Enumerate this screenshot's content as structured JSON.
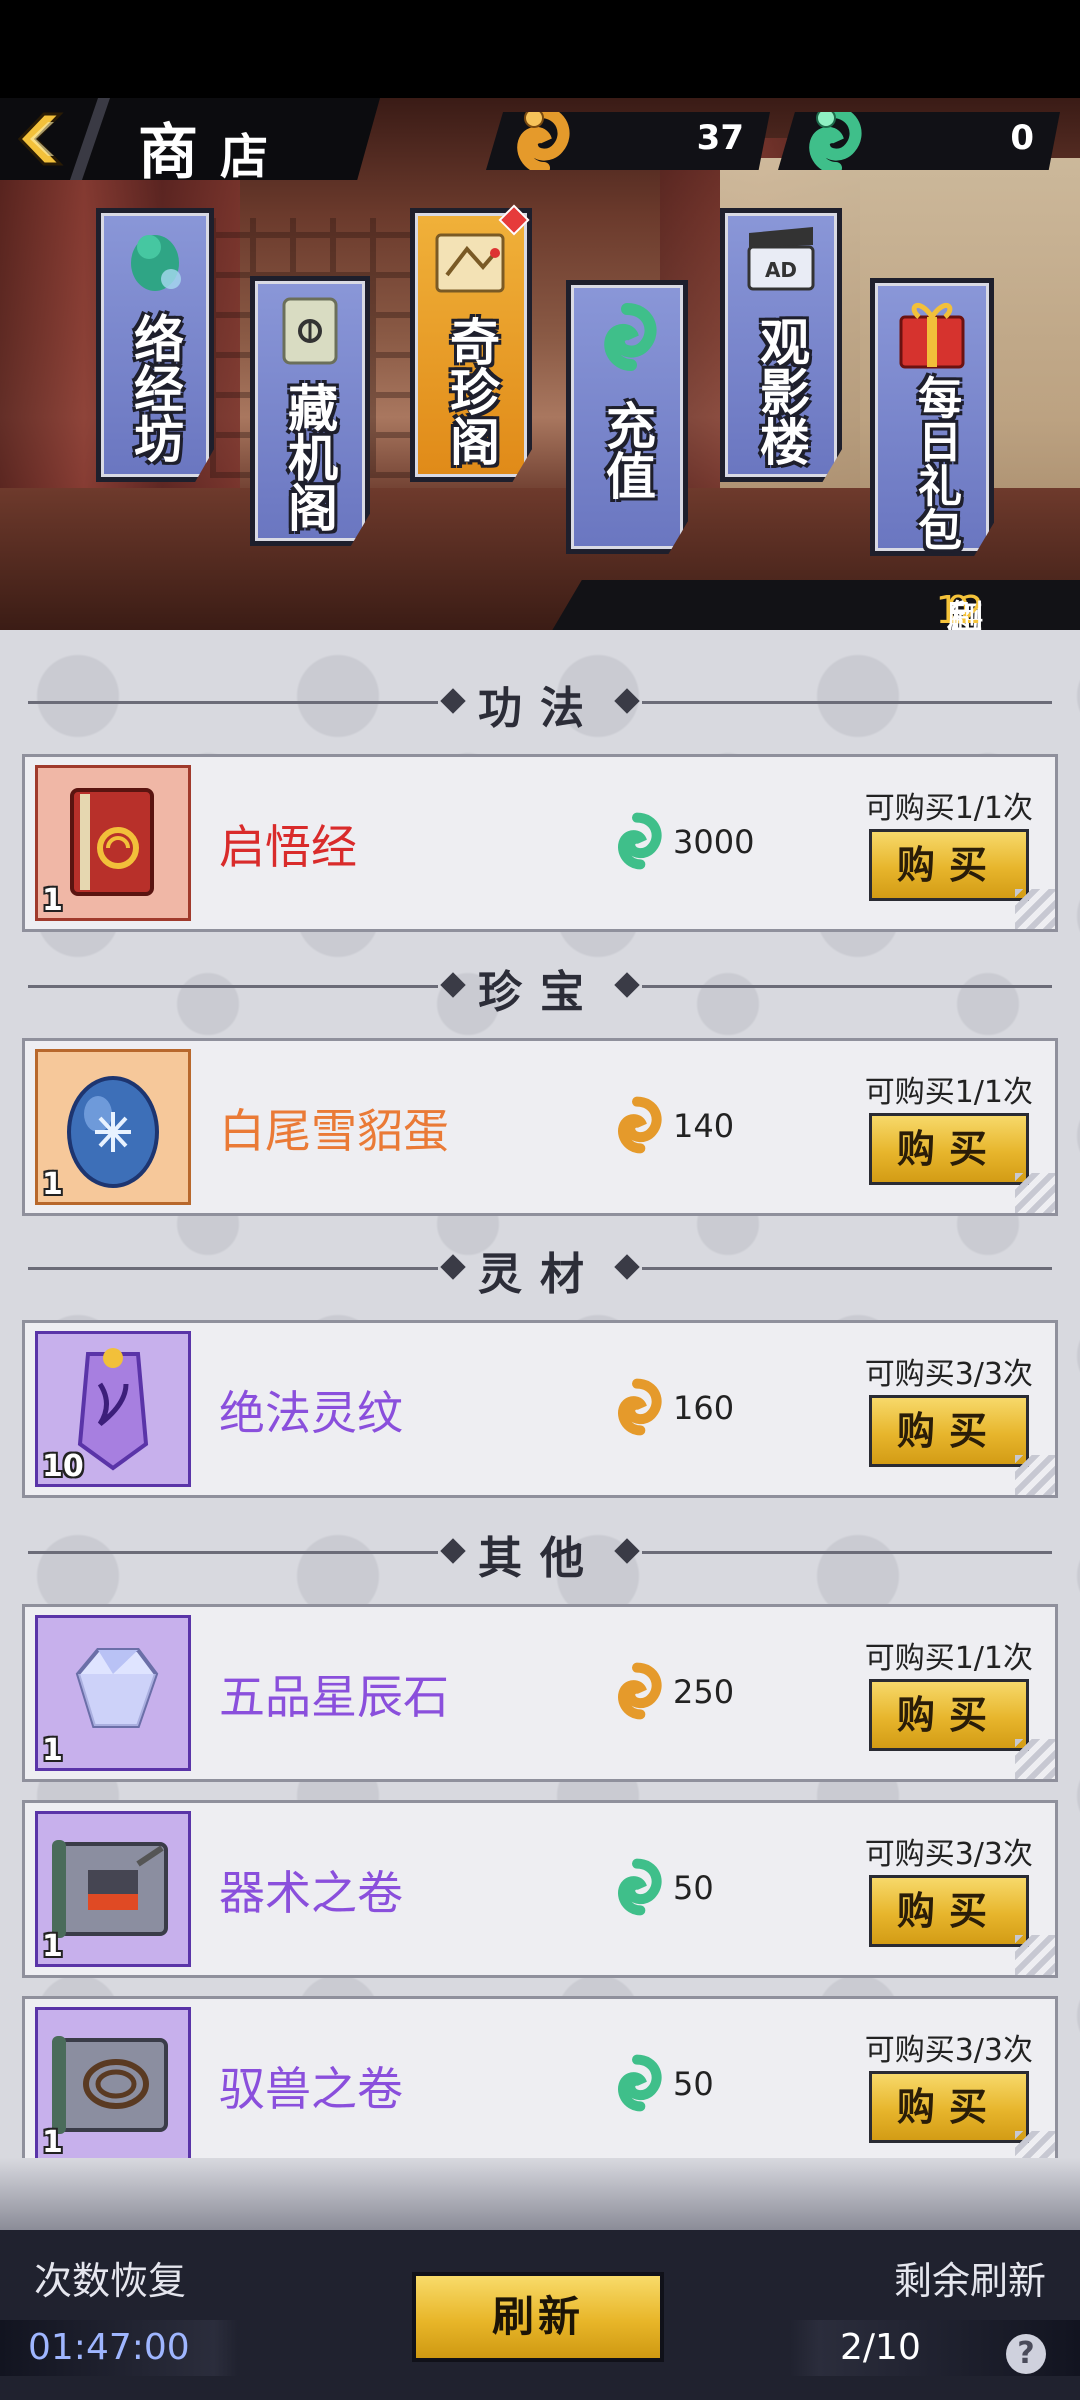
{
  "header": {
    "title_char1": "商",
    "title_char2": "店",
    "currency_gold_value": "37",
    "currency_jade_value": "0"
  },
  "categories": [
    {
      "label": "络经坊",
      "icon": "jade-dragon-icon",
      "active": false
    },
    {
      "label": "藏机阁",
      "icon": "scroll-icon",
      "active": false
    },
    {
      "label": "奇珍阁",
      "icon": "treasure-map-icon",
      "active": true
    },
    {
      "label": "充值",
      "icon": "jade-coin-icon",
      "active": false
    },
    {
      "label": "观影楼",
      "icon": "ad-clapper-icon",
      "active": false
    },
    {
      "label": "每日礼包",
      "icon": "gift-box-icon",
      "active": false
    }
  ],
  "refresh_notice": {
    "prefix": "每日",
    "hour1": "0点",
    "middle": "和",
    "hour2": "12点",
    "suffix": "刷新"
  },
  "sections": [
    {
      "title": "功法"
    },
    {
      "title": "珍宝"
    },
    {
      "title": "灵材"
    },
    {
      "title": "其他"
    }
  ],
  "items": [
    {
      "name": "启悟经",
      "qty": "1",
      "price": "3000",
      "currency": "jade",
      "limit": "可购买1/1次",
      "buy_label": "购买",
      "name_color": "#d92b2b",
      "icon": "book-icon",
      "frame": "#f0b7a6"
    },
    {
      "name": "白尾雪貂蛋",
      "qty": "1",
      "price": "140",
      "currency": "gold",
      "limit": "可购买1/1次",
      "buy_label": "购买",
      "name_color": "#ea7a36",
      "icon": "egg-icon",
      "frame": "#f6c89a"
    },
    {
      "name": "绝法灵纹",
      "qty": "10",
      "price": "160",
      "currency": "gold",
      "limit": "可购买3/3次",
      "buy_label": "购买",
      "name_color": "#8a4fdc",
      "icon": "crystal-talisman-icon",
      "frame": "#c7b0ec"
    },
    {
      "name": "五品星辰石",
      "qty": "1",
      "price": "250",
      "currency": "gold",
      "limit": "可购买1/1次",
      "buy_label": "购买",
      "name_color": "#8a4fdc",
      "icon": "gem-icon",
      "frame": "#c7b0ec"
    },
    {
      "name": "器术之卷",
      "qty": "1",
      "price": "50",
      "currency": "jade",
      "limit": "可购买3/3次",
      "buy_label": "购买",
      "name_color": "#8a4fdc",
      "icon": "forge-scroll-icon",
      "frame": "#c7b0ec"
    },
    {
      "name": "驭兽之卷",
      "qty": "1",
      "price": "50",
      "currency": "jade",
      "limit": "可购买3/3次",
      "buy_label": "购买",
      "name_color": "#8a4fdc",
      "icon": "whip-scroll-icon",
      "frame": "#c7b0ec"
    }
  ],
  "footer": {
    "recover_label": "次数恢复",
    "recover_time": "01:47:00",
    "refresh_button": "刷新",
    "remaining_label": "剩余刷新",
    "remaining_count": "2/10",
    "help_label": "?"
  },
  "colors": {
    "gold_currency": "#e59a2b",
    "jade_currency": "#3fbf8a",
    "highlight": "#f5c33a",
    "active_tab": "#f0b13a",
    "tab": "#7a86cc"
  }
}
